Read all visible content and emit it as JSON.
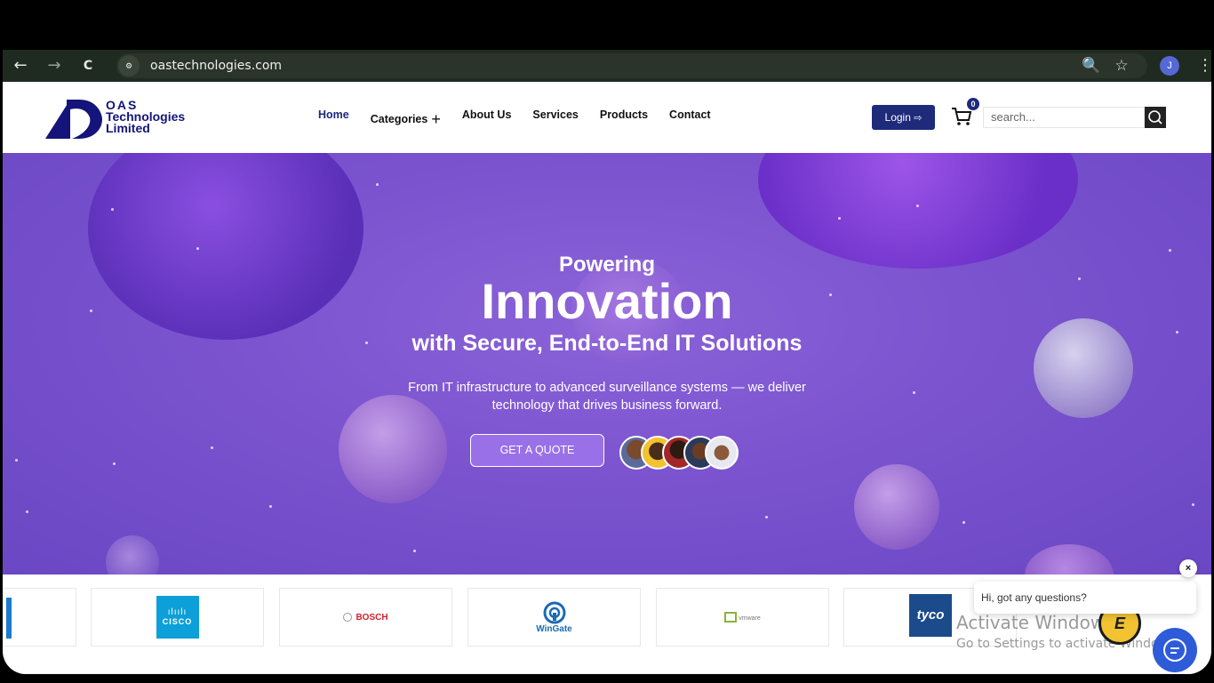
{
  "browser": {
    "url": "oastechnologies.com",
    "back_icon": "←",
    "forward_icon": "→",
    "reload_icon": "C",
    "site_info_icon": "⚙",
    "zoom_icon": "🔍",
    "star_icon": "☆",
    "profile_initial": "J",
    "menu_icon": "⋮"
  },
  "header": {
    "logo": {
      "line1": "OAS",
      "line2": "Technologies",
      "line3": "Limited"
    },
    "nav": [
      {
        "label": "Home",
        "active": true
      },
      {
        "label": "Categories"
      },
      {
        "label": "About Us"
      },
      {
        "label": "Services"
      },
      {
        "label": "Products"
      },
      {
        "label": "Contact"
      }
    ],
    "categories_plus": "+",
    "login_label": "Login",
    "cart_count": "0",
    "search_placeholder": "search...",
    "accent_color": "#1e2a7a"
  },
  "hero": {
    "line1": "Powering",
    "line2": "Innovation",
    "line3": "with Secure, End-to-End IT Solutions",
    "description_1": "From IT infrastructure to advanced surveillance systems — we deliver",
    "description_2": "technology that drives business forward.",
    "cta_label": "GET A QUOTE",
    "background_color": "#7b53cf"
  },
  "brands": {
    "cisco": "CISCO",
    "cisco_bars": "ılıılı",
    "bosch": "BOSCH",
    "wingate": "WinGate",
    "vmware": "vmware",
    "tyco": "tyco"
  },
  "overlay": {
    "activate_title": "Activate Windows",
    "activate_sub": "Go to Settings to activate Windows.",
    "chat_text": "Hi, got any questions?",
    "chat_close": "×",
    "badge_letter": "E"
  }
}
